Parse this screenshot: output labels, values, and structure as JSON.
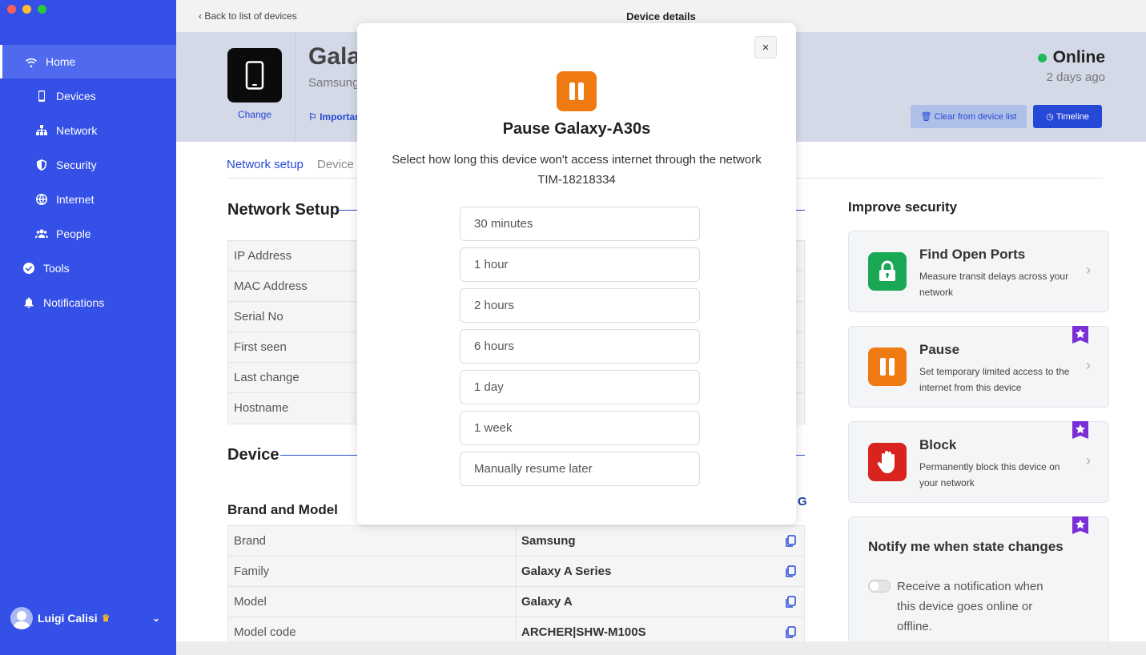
{
  "sidebar": {
    "items": [
      {
        "label": "Home",
        "icon": "wifi-icon"
      },
      {
        "label": "Devices",
        "icon": "phone-icon"
      },
      {
        "label": "Network",
        "icon": "network-icon"
      },
      {
        "label": "Security",
        "icon": "shield-icon"
      },
      {
        "label": "Internet",
        "icon": "globe-icon"
      },
      {
        "label": "People",
        "icon": "people-icon"
      },
      {
        "label": "Tools",
        "icon": "check-circle-icon"
      },
      {
        "label": "Notifications",
        "icon": "bell-icon"
      }
    ],
    "user": {
      "name": "Luigi Calisi",
      "crown": "♛",
      "chevron": "⌄"
    }
  },
  "topbar": {
    "back_label": "Back to list of devices",
    "title": "Device details"
  },
  "device": {
    "name": "Galaxy-A30s",
    "brand": "Samsung",
    "change_label": "Change",
    "important_label": "Important",
    "status": "Online",
    "last_seen": "2 days ago",
    "clear_label": "Clear from device list",
    "timeline_label": "Timeline"
  },
  "tabs": [
    "Network setup",
    "Device"
  ],
  "network_setup": {
    "title": "Network Setup",
    "rows": [
      {
        "key": "IP Address"
      },
      {
        "key": "MAC Address"
      },
      {
        "key": "Serial No"
      },
      {
        "key": "First seen"
      },
      {
        "key": "Last change"
      },
      {
        "key": "Hostname"
      }
    ]
  },
  "device_section": {
    "title": "Device",
    "brand_model_title": "Brand and Model",
    "brand_logo_text": "G",
    "rows": [
      {
        "key": "Brand",
        "value": "Samsung"
      },
      {
        "key": "Family",
        "value": "Galaxy A Series"
      },
      {
        "key": "Model",
        "value": "Galaxy A"
      },
      {
        "key": "Model code",
        "value": "ARCHER|SHW-M100S"
      }
    ]
  },
  "improve": {
    "title": "Improve security",
    "cards": [
      {
        "title": "Find Open Ports",
        "desc": "Measure transit delays across your network",
        "color": "#1aa855",
        "icon": "lock-icon"
      },
      {
        "title": "Pause",
        "desc": "Set temporary limited access to the internet from this device",
        "color": "#f07a12",
        "icon": "pause-icon"
      },
      {
        "title": "Block",
        "desc": "Permanently block this device on your network",
        "color": "#d9231f",
        "icon": "hand-icon"
      }
    ],
    "notify": {
      "title": "Notify me when state changes",
      "toggle_label": "Receive a notification when this device goes online or offline."
    }
  },
  "modal": {
    "close": "×",
    "title": "Pause Galaxy-A30s",
    "desc_line1": "Select how long this device won't access internet through the network",
    "desc_line2": "TIM-18218334",
    "options": [
      "30 minutes",
      "1 hour",
      "2 hours",
      "6 hours",
      "1 day",
      "1 week",
      "Manually resume later"
    ]
  },
  "colors": {
    "sidebar": "#3450e6",
    "accent": "#2648d6",
    "online": "#1fb85b",
    "pause": "#f07a12",
    "premium": "#7b2fd6"
  }
}
